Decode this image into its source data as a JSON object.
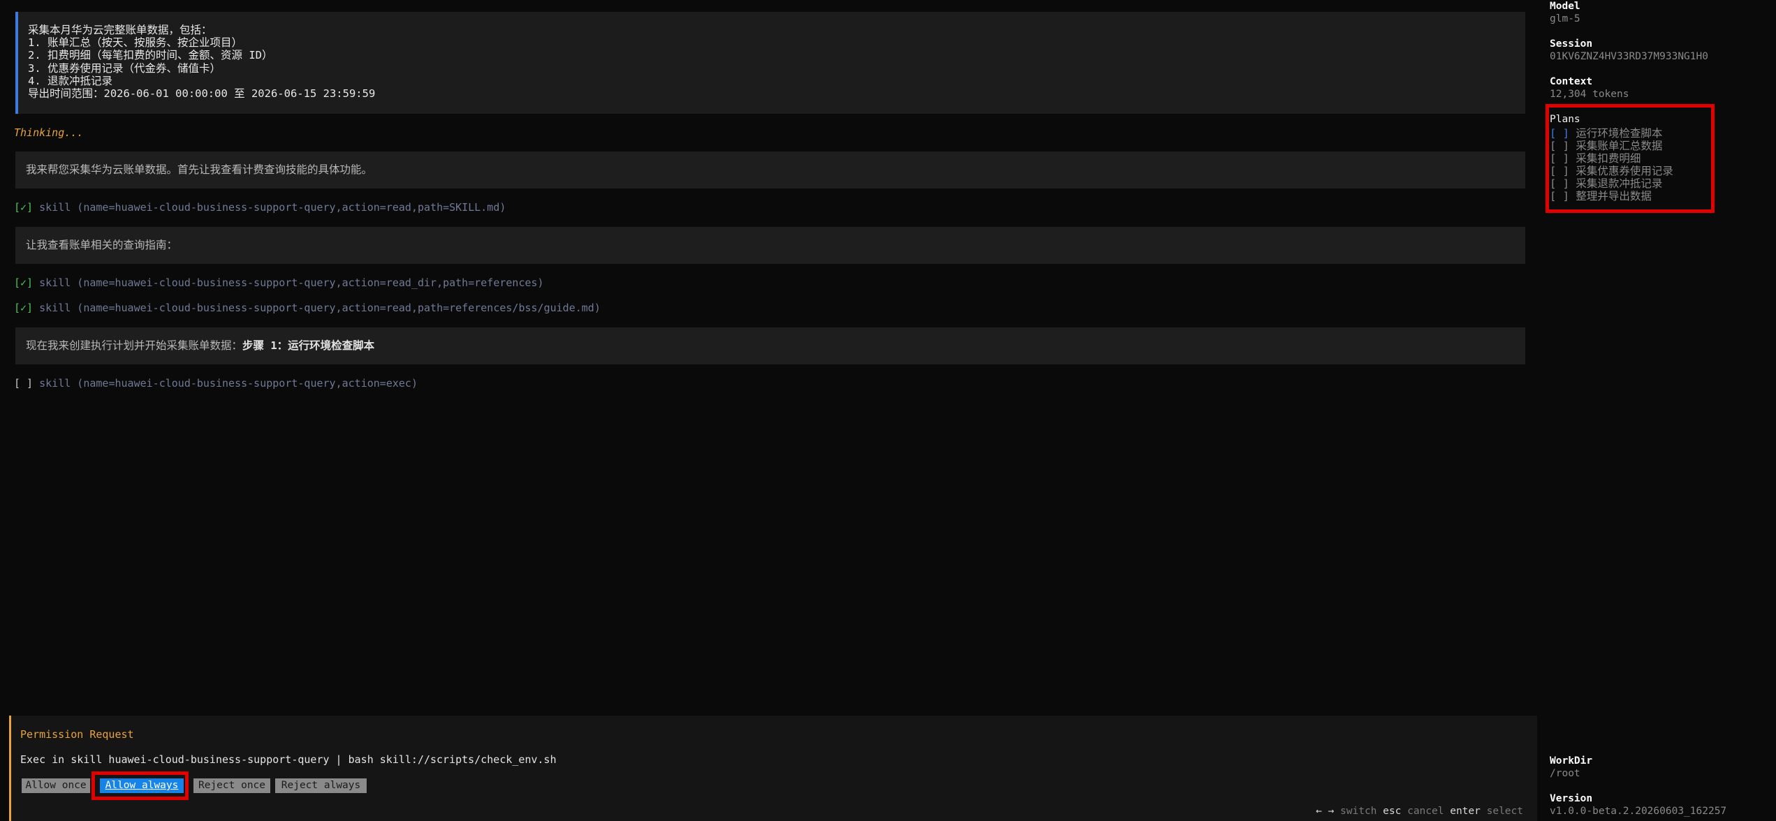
{
  "user_message": {
    "lines": [
      "采集本月华为云完整账单数据，包括：",
      "1. 账单汇总（按天、按服务、按企业项目）",
      "2. 扣费明细（每笔扣费的时间、金额、资源 ID）",
      "3. 优惠券使用记录（代金券、储值卡）",
      "4. 退款冲抵记录",
      "导出时间范围：2026-06-01 00:00:00 至 2026-06-15 23:59:59"
    ]
  },
  "thinking_label": "Thinking...",
  "messages": [
    "我来帮您采集华为云账单数据。首先让我查看计费查询技能的具体功能。",
    "让我查看账单相关的查询指南：",
    "现在我来创建执行计划并开始采集账单数据：",
    "步骤 1：运行环境检查脚本"
  ],
  "tool_calls": [
    {
      "status": "[✓]",
      "text": "skill (name=huawei-cloud-business-support-query,action=read,path=SKILL.md)"
    },
    {
      "status": "[✓]",
      "text": "skill (name=huawei-cloud-business-support-query,action=read_dir,path=references)"
    },
    {
      "status": "[✓]",
      "text": "skill (name=huawei-cloud-business-support-query,action=read,path=references/bss/guide.md)"
    },
    {
      "status": "[ ]",
      "text": "skill (name=huawei-cloud-business-support-query,action=exec)"
    }
  ],
  "permission": {
    "title": "Permission Request",
    "command": "Exec in skill huawei-cloud-business-support-query | bash skill://scripts/check_env.sh",
    "buttons": [
      "Allow once",
      "Allow always",
      "Reject once",
      "Reject always"
    ],
    "selected": "Allow always",
    "hints": {
      "switch_key": "← →",
      "switch_label": "switch",
      "cancel_key": "esc",
      "cancel_label": "cancel",
      "select_key": "enter",
      "select_label": "select"
    }
  },
  "sidebar": {
    "model_label": "Model",
    "model_value": "glm-5",
    "session_label": "Session",
    "session_value": "01KV6ZNZ4HV33RD37M933NG1H0",
    "context_label": "Context",
    "context_value": "12,304 tokens",
    "plans_label": "Plans",
    "plans": [
      "运行环境检查脚本",
      "采集账单汇总数据",
      "采集扣费明细",
      "采集优惠券使用记录",
      "采集退款冲抵记录",
      "整理并导出数据"
    ],
    "plan_checkbox": "[ ]",
    "workdir_label": "WorkDir",
    "workdir_value": "/root",
    "version_label": "Version",
    "version_value": "v1.0.0-beta.2.20260603_162257"
  },
  "colors": {
    "accent_blue": "#3d7be0",
    "selected_button": "#1683e8",
    "thinking_orange": "#e8a33a",
    "success_green": "#4fc15b",
    "highlight_red": "#e00000"
  }
}
